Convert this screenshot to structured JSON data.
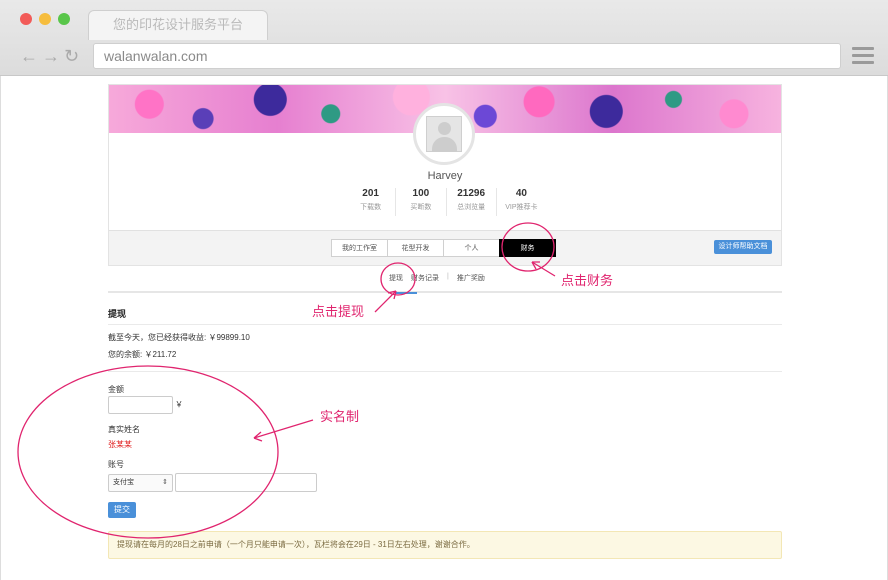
{
  "browser": {
    "tab_title": "您的印花设计服务平台",
    "url": "walanwalan.com"
  },
  "profile": {
    "username": "Harvey",
    "stats": [
      {
        "value": "201",
        "label": "下载数"
      },
      {
        "value": "100",
        "label": "买断数"
      },
      {
        "value": "21296",
        "label": "总浏览量"
      },
      {
        "value": "40",
        "label": "VIP推荐卡"
      }
    ]
  },
  "menu": {
    "tabs": [
      "我的工作室",
      "花型开发",
      "个人",
      "财务"
    ],
    "active_tab": "财务",
    "help_button": "设计师帮助文档"
  },
  "subnav": {
    "items": [
      "提现",
      "财务记录",
      "推广奖励"
    ],
    "active": "提现"
  },
  "withdraw": {
    "title": "提现",
    "earnings_text": "截至今天，您已经获得收益: ￥99899.10",
    "balance_text": "您的余额: ￥211.72",
    "amount_label": "金额",
    "amount_unit": "￥",
    "realname_label": "真实姓名",
    "realname_value": "张某某",
    "account_label": "账号",
    "account_type": "支付宝",
    "submit_label": "提交"
  },
  "notice": "提现请在每月的28日之前申请（一个月只能申请一次），瓦栏将会在29日 - 31日左右处理，谢谢合作。",
  "annotations": {
    "click_finance": "点击财务",
    "click_withdraw": "点击提现",
    "real_name_system": "实名制"
  },
  "colors": {
    "annotation": "#e0246e",
    "primary_button": "#4a90d9",
    "active_tab": "#000000"
  }
}
